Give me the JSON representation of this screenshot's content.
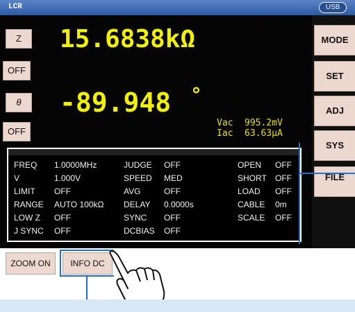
{
  "header": {
    "title": "LCR",
    "usb_label": "USB"
  },
  "left_buttons": [
    {
      "label": "Z"
    },
    {
      "label": "OFF"
    },
    {
      "label": "θ"
    },
    {
      "label": "OFF"
    }
  ],
  "measurements": {
    "primary_value": "15.6838kΩ",
    "secondary_value": "-89.948",
    "secondary_unit": "°",
    "vac_label": "Vac",
    "vac_value": "995.2mV",
    "iac_label": "Iac",
    "iac_value": "63.63µA"
  },
  "right_menu": {
    "mode": "MODE",
    "set": "SET",
    "adj": "ADJ",
    "sys": "SYS",
    "file": "FILE"
  },
  "info_panel": {
    "rows": [
      [
        "FREQ",
        "1.0000MHz",
        "JUDGE",
        "OFF",
        "OPEN",
        "OFF"
      ],
      [
        "V",
        "1.000V",
        "SPEED",
        "MED",
        "SHORT",
        "OFF"
      ],
      [
        "LIMIT",
        "OFF",
        "AVG",
        "OFF",
        "LOAD",
        "OFF"
      ],
      [
        "RANGE",
        "AUTO 100kΩ",
        "DELAY",
        "0.0000s",
        "CABLE",
        "0m"
      ],
      [
        "LOW Z",
        "OFF",
        "SYNC",
        "OFF",
        "SCALE",
        "OFF"
      ],
      [
        "J SYNC",
        "OFF",
        "DCBIAS",
        "OFF",
        "",
        ""
      ]
    ]
  },
  "bottom": {
    "zoom_label": "ZOOM ON",
    "info_label": "INFO DC"
  },
  "colors": {
    "accent": "#2c5aa6",
    "value_yellow": "#f2f200",
    "callout_blue": "#1f6fd1"
  }
}
